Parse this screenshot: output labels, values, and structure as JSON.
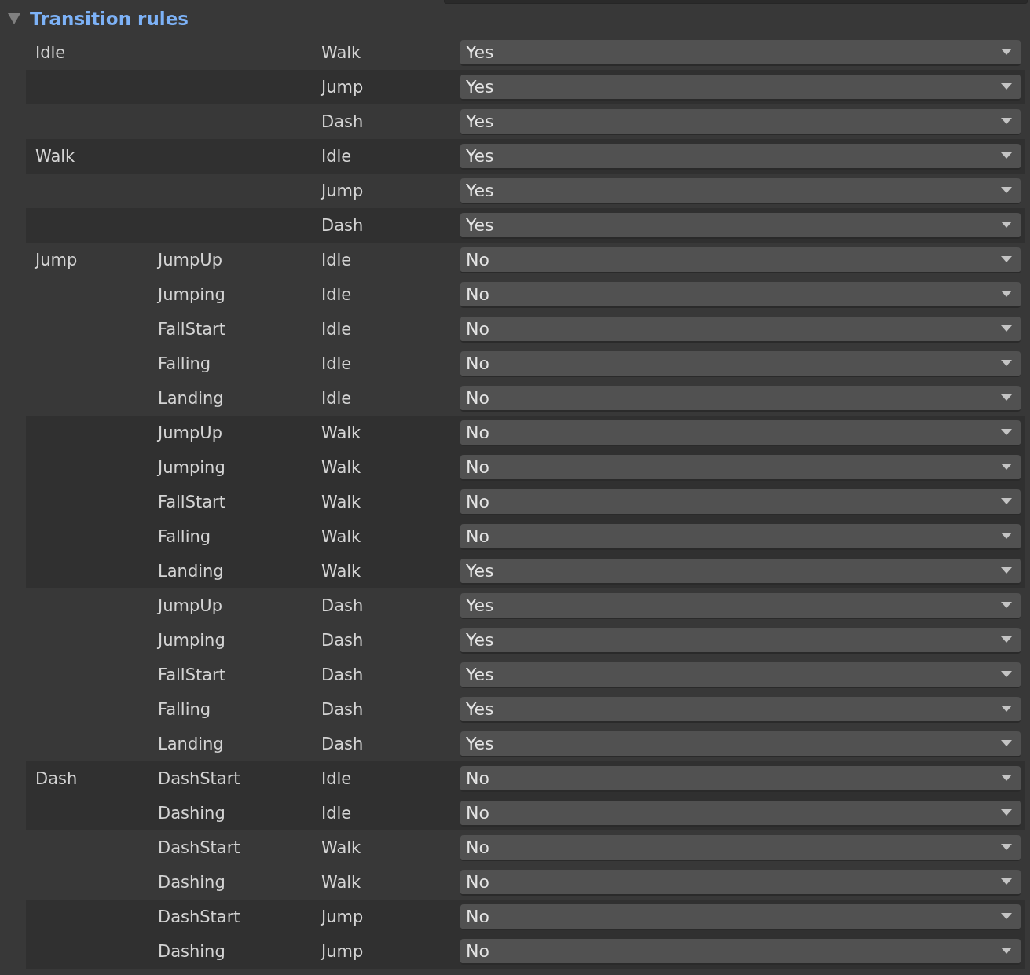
{
  "section": {
    "title": "Transition rules",
    "expanded": true,
    "groups": [
      {
        "from": "Idle",
        "bands": [
          [
            {
              "to": "Walk",
              "value": "Yes"
            }
          ],
          [
            {
              "to": "Jump",
              "value": "Yes"
            }
          ],
          [
            {
              "to": "Dash",
              "value": "Yes"
            }
          ]
        ]
      },
      {
        "from": "Walk",
        "bands": [
          [
            {
              "to": "Idle",
              "value": "Yes"
            }
          ],
          [
            {
              "to": "Jump",
              "value": "Yes"
            }
          ],
          [
            {
              "to": "Dash",
              "value": "Yes"
            }
          ]
        ]
      },
      {
        "from": "Jump",
        "bands": [
          [
            {
              "sub": "JumpUp",
              "to": "Idle",
              "value": "No"
            },
            {
              "sub": "Jumping",
              "to": "Idle",
              "value": "No"
            },
            {
              "sub": "FallStart",
              "to": "Idle",
              "value": "No"
            },
            {
              "sub": "Falling",
              "to": "Idle",
              "value": "No"
            },
            {
              "sub": "Landing",
              "to": "Idle",
              "value": "No"
            }
          ],
          [
            {
              "sub": "JumpUp",
              "to": "Walk",
              "value": "No"
            },
            {
              "sub": "Jumping",
              "to": "Walk",
              "value": "No"
            },
            {
              "sub": "FallStart",
              "to": "Walk",
              "value": "No"
            },
            {
              "sub": "Falling",
              "to": "Walk",
              "value": "No"
            },
            {
              "sub": "Landing",
              "to": "Walk",
              "value": "Yes"
            }
          ],
          [
            {
              "sub": "JumpUp",
              "to": "Dash",
              "value": "Yes"
            },
            {
              "sub": "Jumping",
              "to": "Dash",
              "value": "Yes"
            },
            {
              "sub": "FallStart",
              "to": "Dash",
              "value": "Yes"
            },
            {
              "sub": "Falling",
              "to": "Dash",
              "value": "Yes"
            },
            {
              "sub": "Landing",
              "to": "Dash",
              "value": "Yes"
            }
          ]
        ]
      },
      {
        "from": "Dash",
        "bands": [
          [
            {
              "sub": "DashStart",
              "to": "Idle",
              "value": "No"
            },
            {
              "sub": "Dashing",
              "to": "Idle",
              "value": "No"
            }
          ],
          [
            {
              "sub": "DashStart",
              "to": "Walk",
              "value": "No"
            },
            {
              "sub": "Dashing",
              "to": "Walk",
              "value": "No"
            }
          ],
          [
            {
              "sub": "DashStart",
              "to": "Jump",
              "value": "No"
            },
            {
              "sub": "Dashing",
              "to": "Jump",
              "value": "No"
            }
          ]
        ]
      }
    ]
  }
}
